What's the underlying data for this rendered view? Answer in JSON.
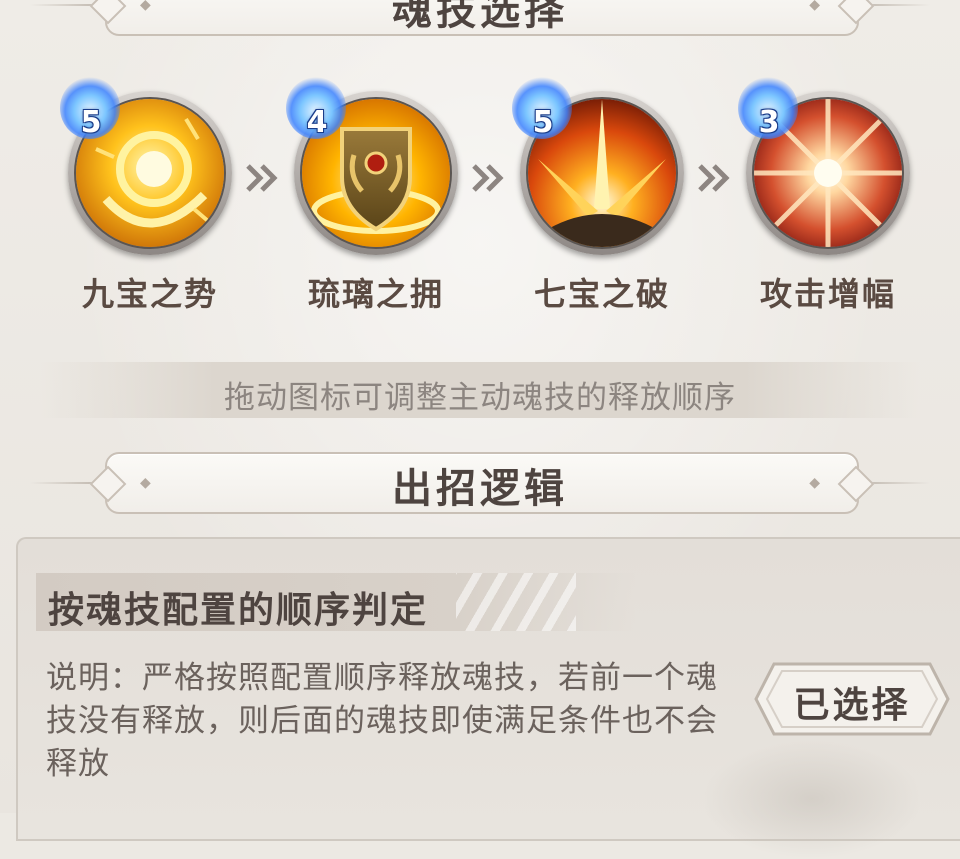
{
  "sections": {
    "skill_select_title": "魂技选择",
    "logic_title": "出招逻辑"
  },
  "skills": [
    {
      "name": "九宝之势",
      "level": "5",
      "icon": "golden-sun-ring-icon"
    },
    {
      "name": "琉璃之拥",
      "level": "4",
      "icon": "golden-shield-icon"
    },
    {
      "name": "七宝之破",
      "level": "5",
      "icon": "fire-burst-icon"
    },
    {
      "name": "攻击增幅",
      "level": "3",
      "icon": "red-radiant-orb-icon"
    }
  ],
  "arrow_icon": "double-chevron-right-icon",
  "hint": "拖动图标可调整主动魂技的释放顺序",
  "logic": {
    "option_title": "按魂技配置的顺序判定",
    "description": "说明：严格按照配置顺序释放魂技，若前一个魂技没有释放，则后面的魂技即使满足条件也不会释放",
    "button_label": "已选择"
  },
  "colors": {
    "background": "#ece9e3",
    "title_text": "#4e4440",
    "level_badge": "#7cc6ff"
  }
}
